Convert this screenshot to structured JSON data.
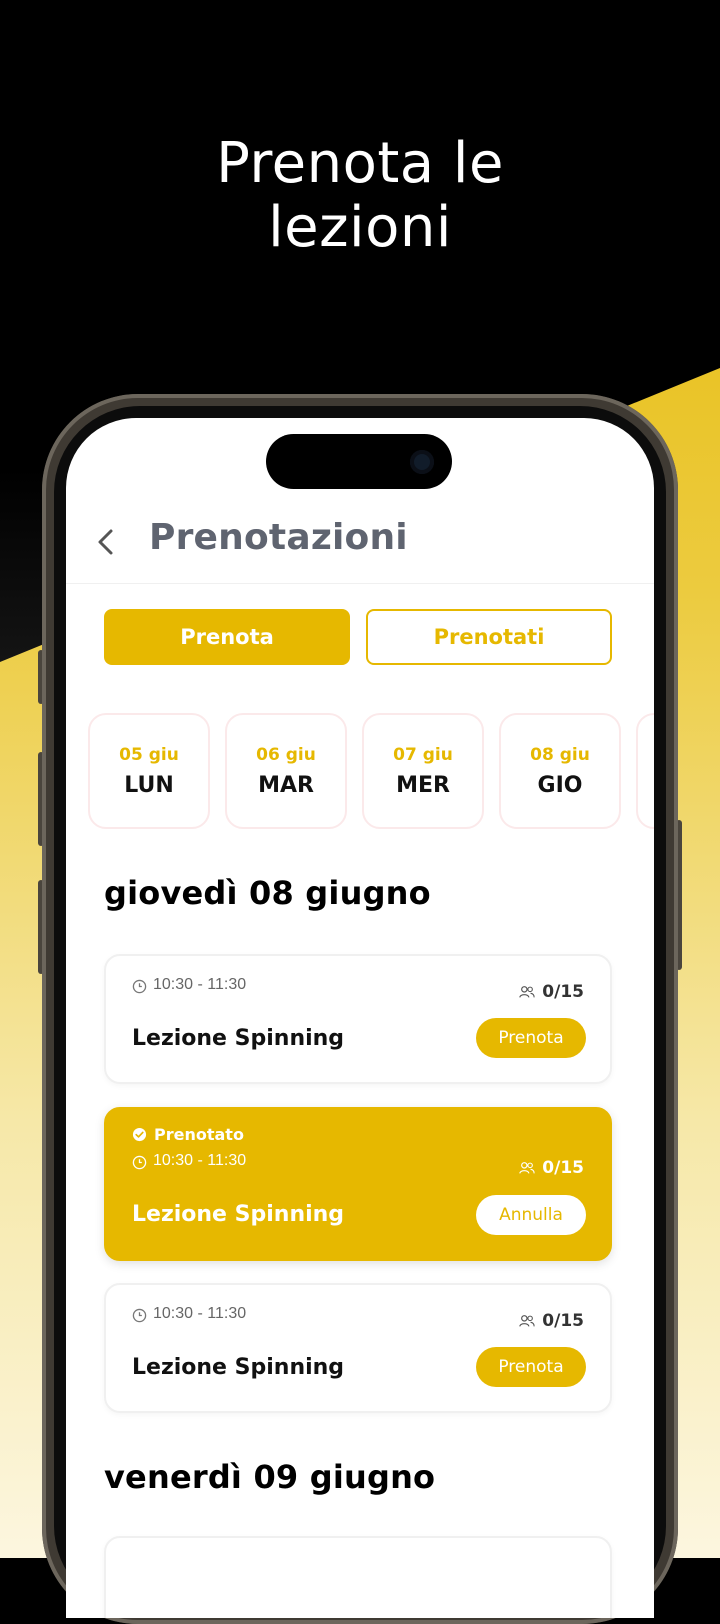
{
  "headline": {
    "line1": "Prenota le",
    "line2": "lezioni"
  },
  "header": {
    "title": "Prenotazioni"
  },
  "tabs": [
    {
      "label": "Prenota",
      "active": true
    },
    {
      "label": "Prenotati",
      "active": false
    }
  ],
  "days": [
    {
      "date": "05 giu",
      "name": "LUN"
    },
    {
      "date": "06 giu",
      "name": "MAR"
    },
    {
      "date": "07 giu",
      "name": "MER"
    },
    {
      "date": "08 giu",
      "name": "GIO"
    }
  ],
  "sections": [
    {
      "heading": "giovedì 08 giugno"
    },
    {
      "heading": "venerdì 09 giugno"
    }
  ],
  "lessons": [
    {
      "time": "10:30 - 11:30",
      "count": "0/15",
      "title": "Lezione Spinning",
      "button": "Prenota",
      "booked": false,
      "status": ""
    },
    {
      "time": "10:30 - 11:30",
      "count": "0/15",
      "title": "Lezione Spinning",
      "button": "Annulla",
      "booked": true,
      "status": "Prenotato"
    },
    {
      "time": "10:30 - 11:30",
      "count": "0/15",
      "title": "Lezione Spinning",
      "button": "Prenota",
      "booked": false,
      "status": ""
    }
  ],
  "colors": {
    "accent": "#e6b800",
    "dark": "#000000",
    "text": "#111111",
    "muted": "#5f6470"
  }
}
